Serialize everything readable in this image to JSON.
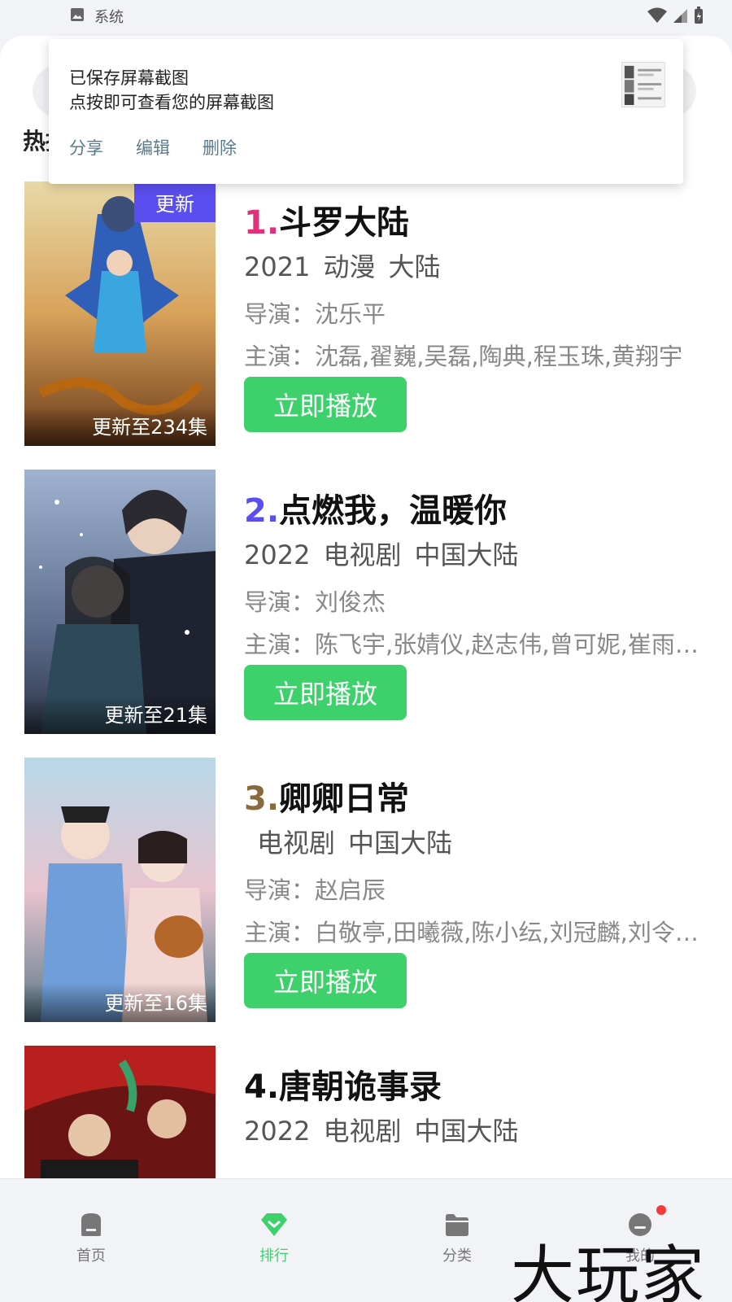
{
  "status_bar": {
    "label": "系统"
  },
  "section": {
    "title": "热播"
  },
  "toast": {
    "line1": "已保存屏幕截图",
    "line2": "点按即可查看您的屏幕截图",
    "share": "分享",
    "edit": "编辑",
    "delete": "删除"
  },
  "rank_colors": [
    "#e0327a",
    "#5b4ef0",
    "#8a6a3c",
    "#111111"
  ],
  "items": [
    {
      "rank": "1.",
      "name": "斗罗大陆",
      "year": "2021",
      "genre": "动漫",
      "region": "大陆",
      "director": "导演：沈乐平",
      "cast": "主演：沈磊,翟巍,吴磊,陶典,程玉珠,黄翔宇",
      "badge": "更新",
      "episode": "更新至234集",
      "play": "立即播放"
    },
    {
      "rank": "2.",
      "name": "点燃我，温暖你",
      "year": "2022",
      "genre": "电视剧",
      "region": "中国大陆",
      "director": "导演：刘俊杰",
      "cast": "主演：陈飞宇,张婧仪,赵志伟,曾可妮,崔雨…",
      "episode": "更新至21集",
      "play": "立即播放"
    },
    {
      "rank": "3.",
      "name": "卿卿日常",
      "year": "",
      "genre": "电视剧",
      "region": "中国大陆",
      "director": "导演：赵启辰",
      "cast": "主演：白敬亭,田曦薇,陈小纭,刘冠麟,刘令…",
      "episode": "更新至16集",
      "play": "立即播放"
    },
    {
      "rank": "4.",
      "name": "唐朝诡事录",
      "year": "2022",
      "genre": "电视剧",
      "region": "中国大陆"
    }
  ],
  "tabs": [
    {
      "label": "首页",
      "icon": "home-icon"
    },
    {
      "label": "排行",
      "icon": "rank-diamond-icon"
    },
    {
      "label": "分类",
      "icon": "folder-icon"
    },
    {
      "label": "我的",
      "icon": "profile-icon"
    }
  ],
  "watermark": "大玩家"
}
